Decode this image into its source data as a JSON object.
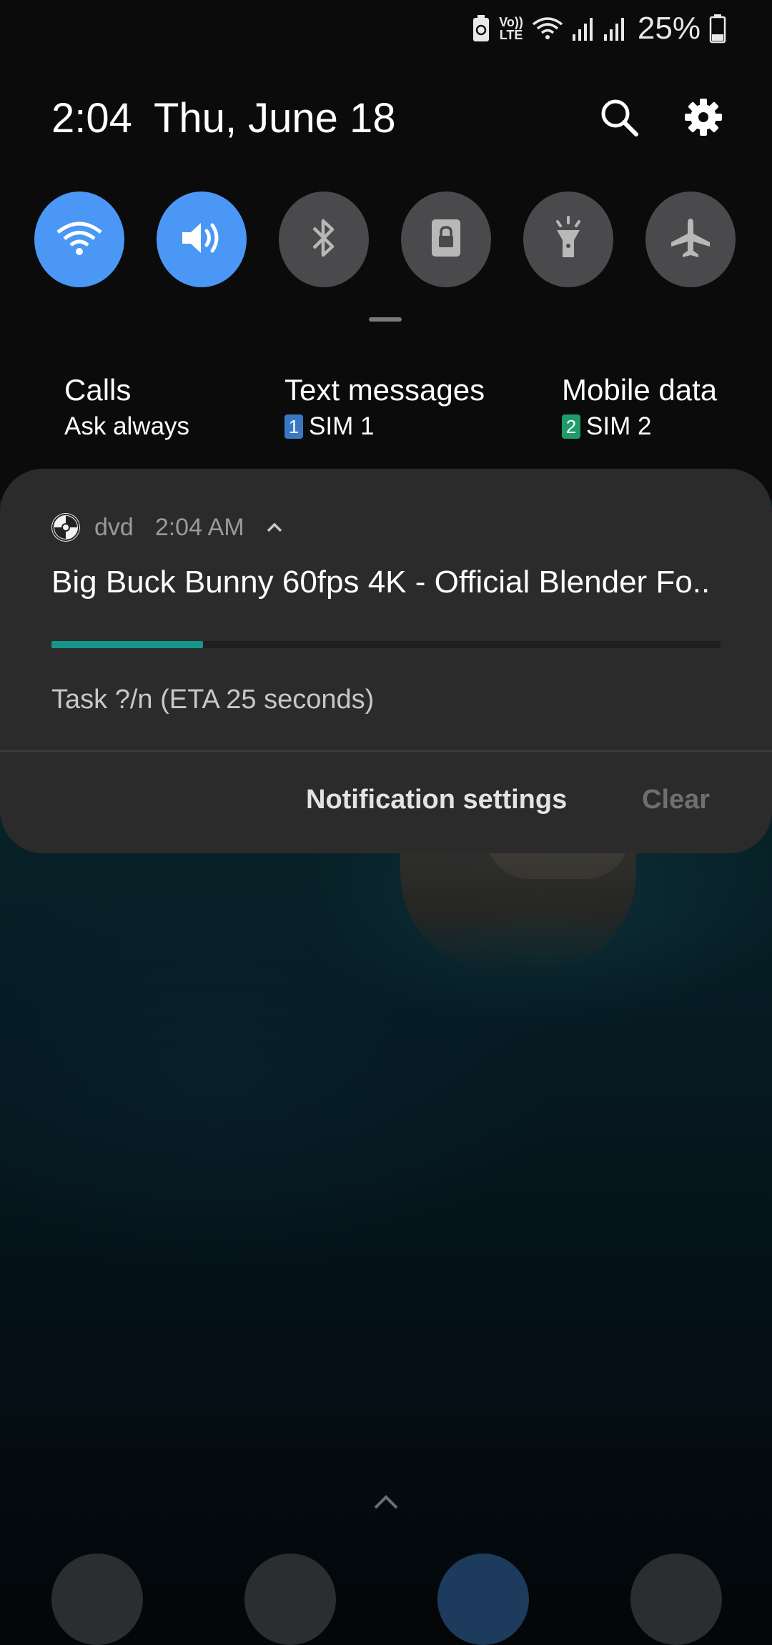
{
  "status_bar": {
    "battery_percent": "25%",
    "icons": [
      "battery-saver-icon",
      "volte-icon",
      "wifi-icon",
      "signal-sim1-icon",
      "signal-sim2-icon",
      "battery-icon"
    ],
    "volte_line1": "Vo))",
    "volte_line2": "LTE"
  },
  "header": {
    "time": "2:04",
    "date": "Thu, June 18",
    "search_icon": "search-icon",
    "settings_icon": "gear-icon"
  },
  "quick_toggles": [
    {
      "name": "wifi",
      "icon": "wifi-icon",
      "on": true
    },
    {
      "name": "sound",
      "icon": "volume-icon",
      "on": true
    },
    {
      "name": "bluetooth",
      "icon": "bluetooth-icon",
      "on": false
    },
    {
      "name": "screen-lock",
      "icon": "lock-icon",
      "on": false
    },
    {
      "name": "flashlight",
      "icon": "flashlight-icon",
      "on": false
    },
    {
      "name": "airplane-mode",
      "icon": "airplane-icon",
      "on": false
    }
  ],
  "sim_settings": {
    "calls": {
      "title": "Calls",
      "value": "Ask always"
    },
    "text_messages": {
      "title": "Text messages",
      "badge": "1",
      "value": "SIM 1",
      "badge_color": "#3a78c4"
    },
    "mobile_data": {
      "title": "Mobile data",
      "badge": "2",
      "value": "SIM 2",
      "badge_color": "#1f9a6a"
    }
  },
  "notification": {
    "app_name": "dvd",
    "time": "2:04 AM",
    "title": "Big Buck Bunny 60fps 4K - Official Blender Fo..",
    "progress_fraction": 0.227,
    "progress_color": "#16958a",
    "text": "Task ?/n (ETA 25 seconds)",
    "actions": {
      "settings": "Notification settings",
      "clear": "Clear"
    }
  },
  "colors": {
    "toggle_on": "#4a97f5",
    "toggle_off": "#4a4a4c",
    "card_bg": "#2b2b2c"
  }
}
